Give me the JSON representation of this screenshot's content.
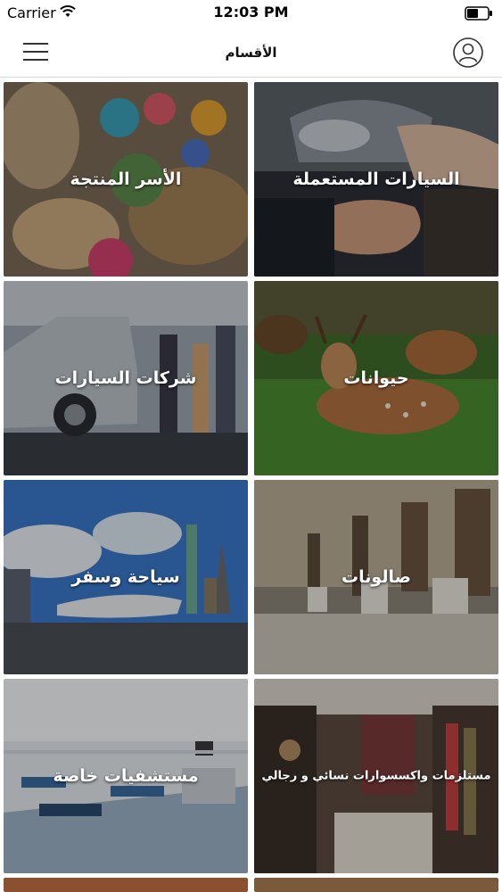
{
  "status_bar": {
    "carrier": "Carrier",
    "time": "12:03 PM"
  },
  "nav": {
    "title": "الأقسام",
    "menu_icon": "hamburger-icon",
    "profile_icon": "user-icon"
  },
  "categories": [
    {
      "label": "السيارات المستعملة",
      "image": "used-cars"
    },
    {
      "label": "الأسر المنتجة",
      "image": "handmade-baskets"
    },
    {
      "label": "حيوانات",
      "image": "deer"
    },
    {
      "label": "شركات السيارات",
      "image": "car-showroom"
    },
    {
      "label": "صالونات",
      "image": "salon"
    },
    {
      "label": "سياحة وسفر",
      "image": "travel"
    },
    {
      "label": "مستلزمات واكسسوارات نسائي و رجالي",
      "image": "clothing-store"
    },
    {
      "label": "مستشفيات خاصة",
      "image": "hospital"
    }
  ],
  "colors": {
    "accent": "#333333",
    "divider": "#d6d6d6"
  }
}
